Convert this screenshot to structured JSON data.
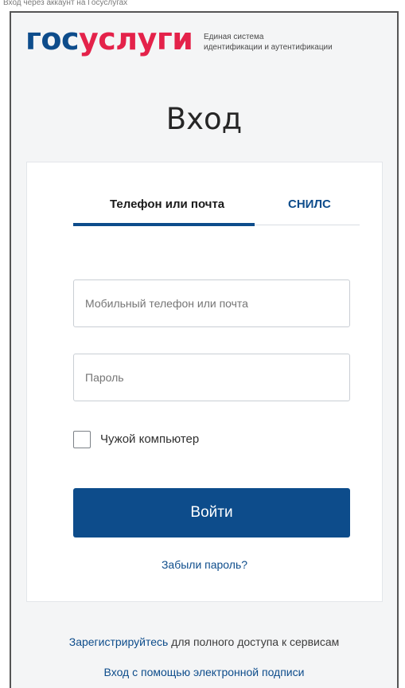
{
  "page_caption": "Вход через аккаунт на Госуслугах",
  "header": {
    "logo_part1": "гос",
    "logo_part2": "услуги",
    "system_line1": "Единая система",
    "system_line2": "идентификации и аутентификации"
  },
  "title": "Вход",
  "tabs": [
    {
      "label": "Телефон или почта",
      "active": true
    },
    {
      "label": "СНИЛС",
      "active": false
    }
  ],
  "form": {
    "login_placeholder": "Мобильный телефон или почта",
    "password_placeholder": "Пароль",
    "checkbox_label": "Чужой компьютер",
    "checkbox_checked": false,
    "submit_label": "Войти",
    "forgot_label": "Забыли пароль?"
  },
  "footer": {
    "register_link": "Зарегистрируйтесь",
    "register_rest": " для полного доступа к сервисам",
    "signature_link": "Вход с помощью электронной подписи"
  },
  "colors": {
    "brand_blue": "#0d4c8b",
    "brand_red": "#e4224a",
    "page_bg": "#f4f5f6"
  }
}
